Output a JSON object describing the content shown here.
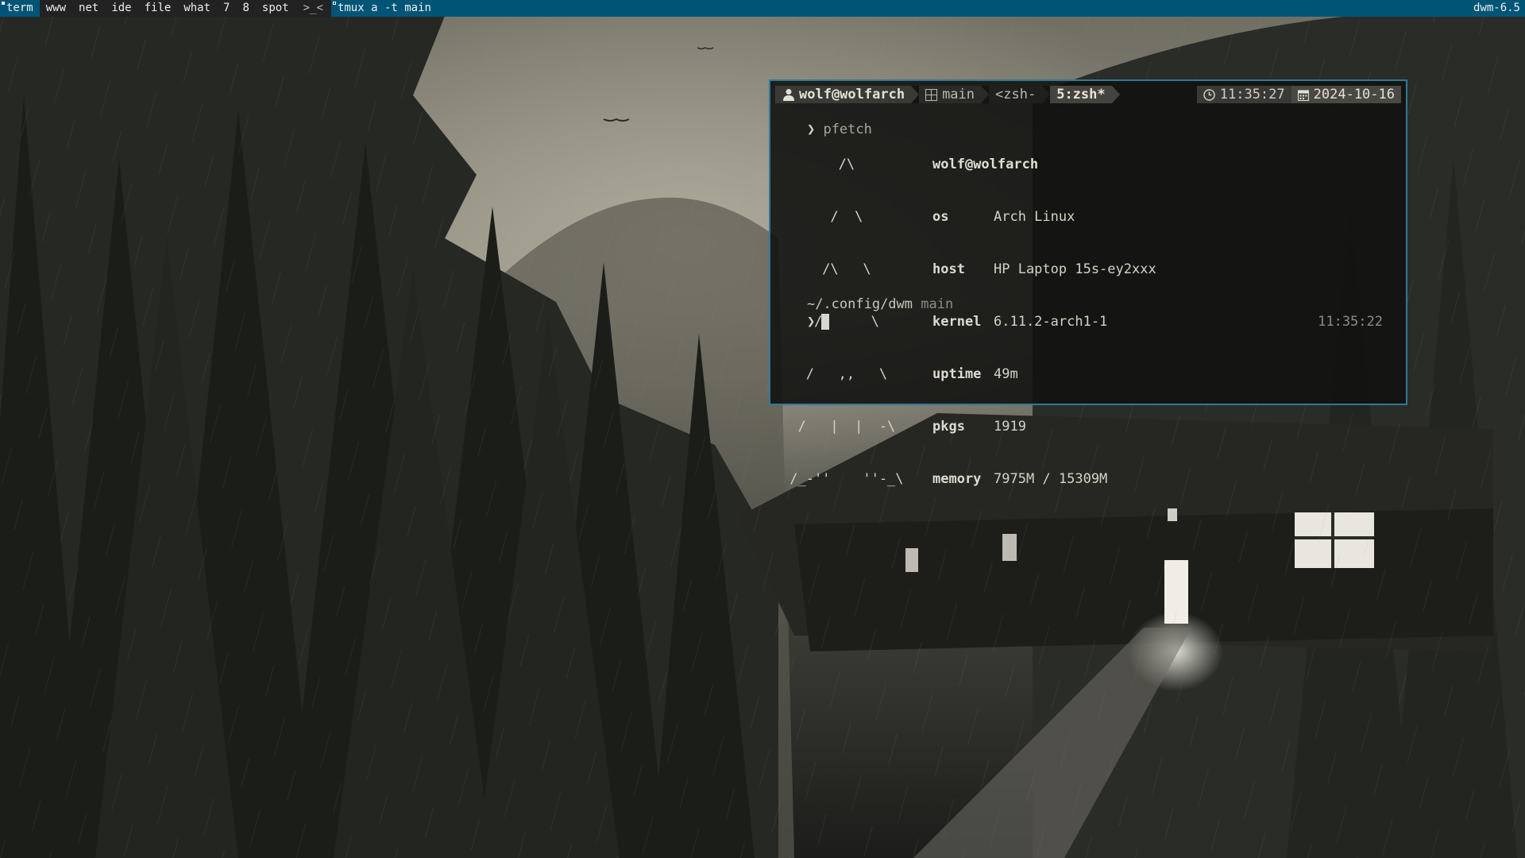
{
  "bar": {
    "tags": [
      "term",
      "www",
      "net",
      "ide",
      "file",
      "what",
      "7",
      "8",
      "spot"
    ],
    "selected_tag": "term",
    "layout_symbol": ">_<",
    "window_title": "tmux a -t main",
    "status": "dwm-6.5",
    "colors": {
      "bar_selected": "#005577",
      "bar_normal": "#222222",
      "text": "#eeeeee"
    }
  },
  "tmux": {
    "user": "wolf@wolfarch",
    "session": "main",
    "windows": [
      "<zsh-",
      "5:zsh*"
    ],
    "time": "11:35:27",
    "date": "2024-10-16",
    "icons": {
      "user": "user-icon",
      "session": "grid-icon",
      "time": "clock-icon",
      "date": "calendar-icon"
    }
  },
  "terminal": {
    "prompt_symbol": "❯",
    "command": "pfetch",
    "logo_lines": [
      "       /\\",
      "      /  \\",
      "     /\\   \\",
      "    /      \\",
      "   /   ,,   \\",
      "  /   |  |  -\\",
      " /_-''    ''-_\\"
    ],
    "info_title": "wolf@wolfarch",
    "info": [
      {
        "key": "os",
        "value": "Arch Linux"
      },
      {
        "key": "host",
        "value": "HP Laptop 15s-ey2xxx"
      },
      {
        "key": "kernel",
        "value": "6.11.2-arch1-1"
      },
      {
        "key": "uptime",
        "value": "49m"
      },
      {
        "key": "pkgs",
        "value": "1919"
      },
      {
        "key": "memory",
        "value": "7975M / 15309M"
      }
    ],
    "cwd": "~/.config/dwm",
    "branch": "main",
    "right_time": "11:35:22",
    "border_color": "#2f7a97"
  }
}
